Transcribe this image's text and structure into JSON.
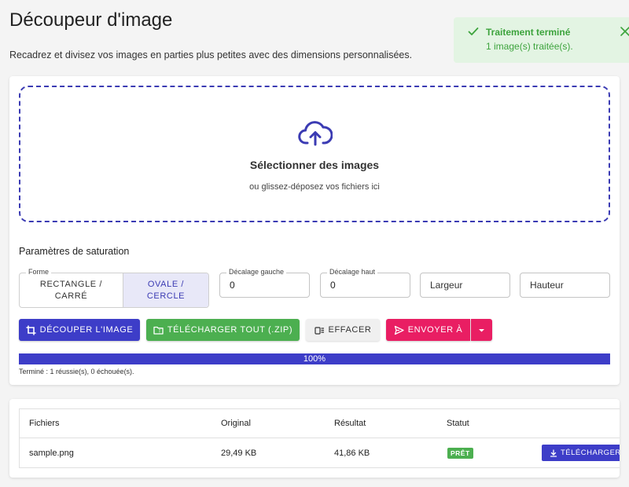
{
  "header": {
    "title": "Découpeur d'image",
    "subtitle": "Recadrez et divisez vos images en parties plus petites avec des dimensions personnalisées."
  },
  "toast": {
    "title": "Traitement terminé",
    "message": "1 image(s) traitée(s).",
    "check_icon": "check-icon",
    "close_icon": "close-icon",
    "color": "#3ca33c",
    "background": "#e3f4e3"
  },
  "dropzone": {
    "icon": "cloud-upload-icon",
    "title": "Sélectionner des images",
    "subtitle": "ou glissez-déposez vos fichiers ici"
  },
  "settings": {
    "section_label": "Paramètres de saturation",
    "shape": {
      "legend": "Forme",
      "options": [
        {
          "line1": "RECTANGLE /",
          "line2": "CARRÉ",
          "selected": false
        },
        {
          "line1": "OVALE /",
          "line2": "CERCLE",
          "selected": true
        }
      ]
    },
    "offset_left": {
      "legend": "Décalage gauche",
      "value": "0"
    },
    "offset_top": {
      "legend": "Décalage haut",
      "value": "0"
    },
    "width": {
      "placeholder": "Largeur"
    },
    "height": {
      "placeholder": "Hauteur"
    }
  },
  "actions": {
    "crop": "DÉCOUPER L'IMAGE",
    "download_all": "TÉLÉCHARGER TOUT (.ZIP)",
    "clear": "EFFACER",
    "send": "ENVOYER À",
    "colors": {
      "primary": "#3d3dc8",
      "success": "#4caf50",
      "accent": "#e91e63"
    }
  },
  "progress": {
    "percent": 100,
    "label": "100%",
    "status": "Terminé : 1 réussie(s), 0 échouée(s)."
  },
  "table": {
    "headers": [
      "Fichiers",
      "Original",
      "Résultat",
      "Statut"
    ],
    "rows": [
      {
        "file": "sample.png",
        "original": "29,49 KB",
        "result": "41,86 KB",
        "status": "PRÊT",
        "action": "TÉLÉCHARGER"
      }
    ]
  }
}
